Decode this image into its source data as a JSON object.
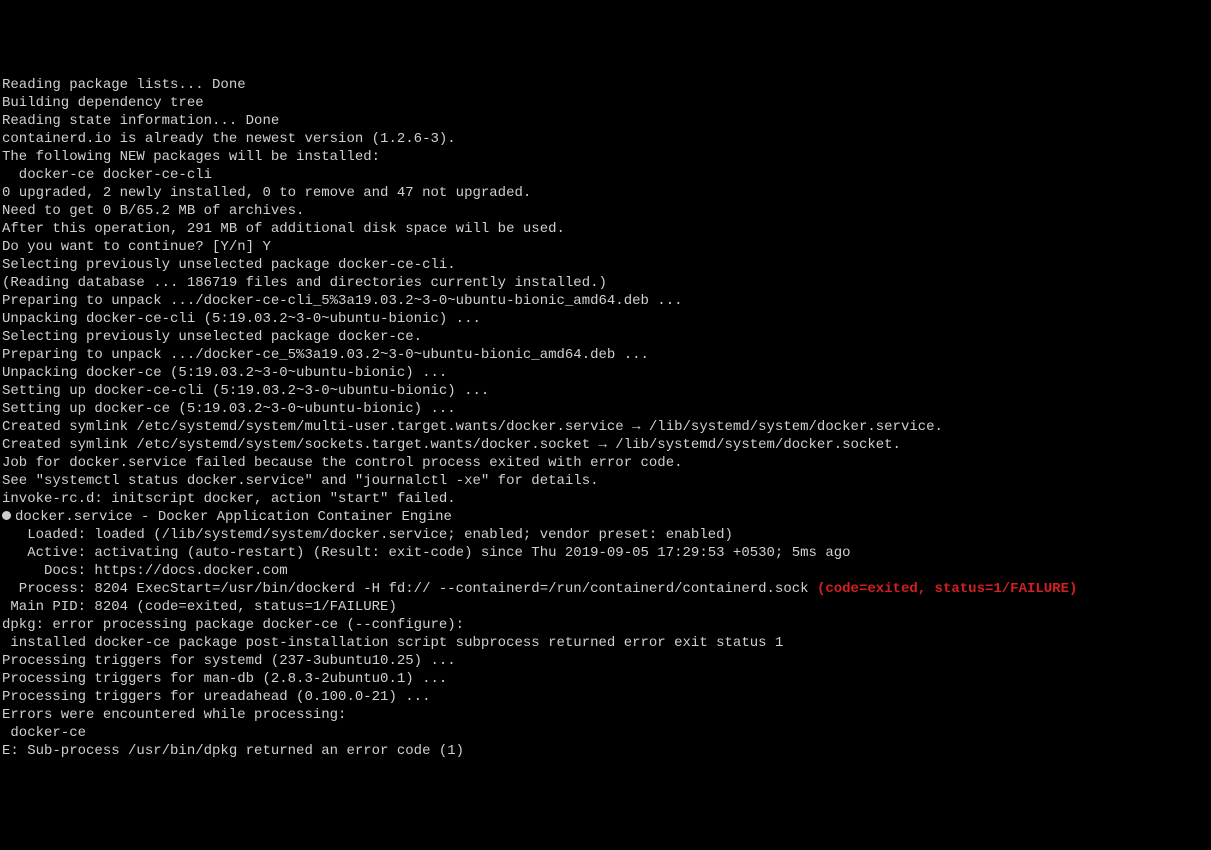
{
  "lines": [
    {
      "text": "Reading package lists... Done"
    },
    {
      "text": "Building dependency tree"
    },
    {
      "text": "Reading state information... Done"
    },
    {
      "text": "containerd.io is already the newest version (1.2.6-3)."
    },
    {
      "text": "The following NEW packages will be installed:"
    },
    {
      "text": "  docker-ce docker-ce-cli"
    },
    {
      "text": "0 upgraded, 2 newly installed, 0 to remove and 47 not upgraded."
    },
    {
      "text": "Need to get 0 B/65.2 MB of archives."
    },
    {
      "text": "After this operation, 291 MB of additional disk space will be used."
    },
    {
      "text": "Do you want to continue? [Y/n] Y"
    },
    {
      "text": "Selecting previously unselected package docker-ce-cli."
    },
    {
      "text": "(Reading database ... 186719 files and directories currently installed.)"
    },
    {
      "text": "Preparing to unpack .../docker-ce-cli_5%3a19.03.2~3-0~ubuntu-bionic_amd64.deb ..."
    },
    {
      "text": "Unpacking docker-ce-cli (5:19.03.2~3-0~ubuntu-bionic) ..."
    },
    {
      "text": "Selecting previously unselected package docker-ce."
    },
    {
      "text": "Preparing to unpack .../docker-ce_5%3a19.03.2~3-0~ubuntu-bionic_amd64.deb ..."
    },
    {
      "text": "Unpacking docker-ce (5:19.03.2~3-0~ubuntu-bionic) ..."
    },
    {
      "text": "Setting up docker-ce-cli (5:19.03.2~3-0~ubuntu-bionic) ..."
    },
    {
      "text": "Setting up docker-ce (5:19.03.2~3-0~ubuntu-bionic) ..."
    },
    {
      "text": "Created symlink /etc/systemd/system/multi-user.target.wants/docker.service → /lib/systemd/system/docker.service."
    },
    {
      "text": "Created symlink /etc/systemd/system/sockets.target.wants/docker.socket → /lib/systemd/system/docker.socket."
    },
    {
      "text": "Job for docker.service failed because the control process exited with error code."
    },
    {
      "text": "See \"systemctl status docker.service\" and \"journalctl -xe\" for details."
    },
    {
      "text": "invoke-rc.d: initscript docker, action \"start\" failed."
    },
    {
      "dot": true,
      "text": "docker.service - Docker Application Container Engine"
    },
    {
      "text": "   Loaded: loaded (/lib/systemd/system/docker.service; enabled; vendor preset: enabled)"
    },
    {
      "text": "   Active: activating (auto-restart) (Result: exit-code) since Thu 2019-09-05 17:29:53 +0530; 5ms ago"
    },
    {
      "text": "     Docs: https://docs.docker.com"
    },
    {
      "text": "  Process: 8204 ExecStart=/usr/bin/dockerd -H fd:// --containerd=/run/containerd/containerd.sock ",
      "suffix_red": "(code=exited, status=1/FAILURE)"
    },
    {
      "text": " Main PID: 8204 (code=exited, status=1/FAILURE)"
    },
    {
      "text": "dpkg: error processing package docker-ce (--configure):"
    },
    {
      "text": " installed docker-ce package post-installation script subprocess returned error exit status 1"
    },
    {
      "text": "Processing triggers for systemd (237-3ubuntu10.25) ..."
    },
    {
      "text": "Processing triggers for man-db (2.8.3-2ubuntu0.1) ..."
    },
    {
      "text": "Processing triggers for ureadahead (0.100.0-21) ..."
    },
    {
      "text": "Errors were encountered while processing:"
    },
    {
      "text": " docker-ce"
    },
    {
      "text": "E: Sub-process /usr/bin/dpkg returned an error code (1)"
    }
  ]
}
